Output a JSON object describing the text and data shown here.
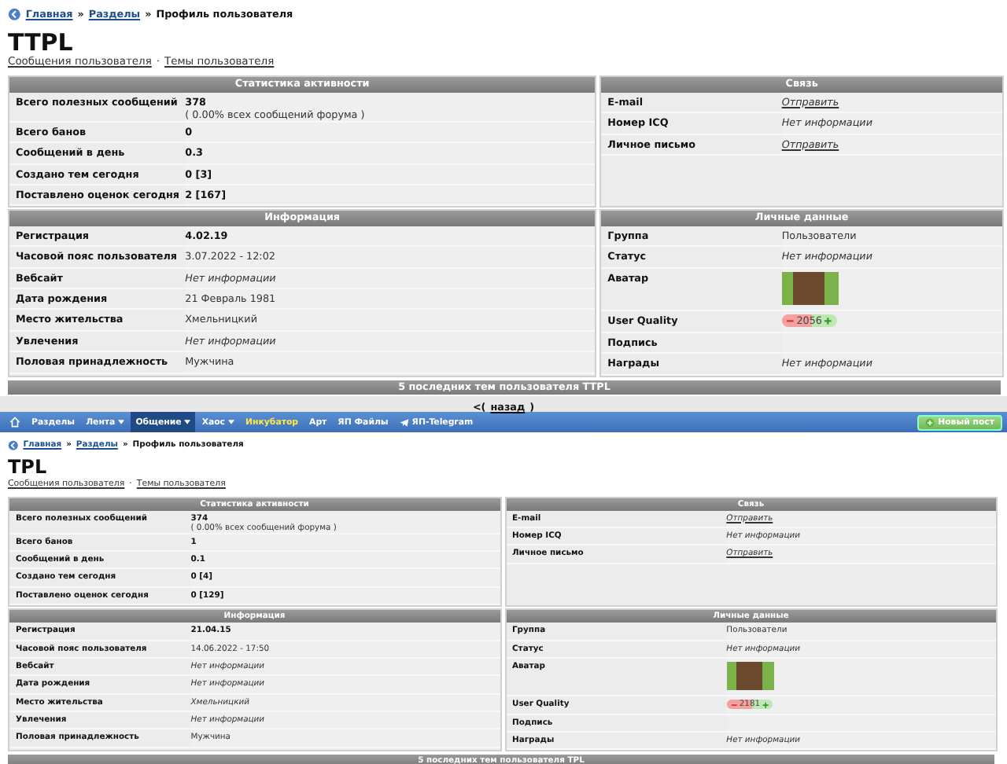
{
  "pages": [
    {
      "breadcrumb": {
        "links": [
          "Главная",
          "Разделы"
        ],
        "separator": "»",
        "current": "Профиль пользователя"
      },
      "title": "TTPL",
      "user_links": [
        "Сообщения пользователя",
        "Темы пользователя"
      ],
      "link_separator": "·",
      "sections": [
        {
          "title": "Статистика активности",
          "rows": [
            {
              "label": "Всего полезных сообщений",
              "kind": "bold",
              "value": "378",
              "note": "( 0.00% всех сообщений форума )"
            },
            {
              "label": "Всего банов",
              "kind": "bold",
              "value": "0"
            },
            {
              "label": "Сообщений в день",
              "kind": "bold",
              "value": "0.3"
            },
            {
              "label": "Создано тем сегодня",
              "kind": "bold",
              "value": "0 [3]"
            },
            {
              "label": "Поставлено оценок сегодня",
              "kind": "bold",
              "value": "2 [167]"
            }
          ]
        },
        {
          "title": "Связь",
          "rows": [
            {
              "label": "E-mail",
              "kind": "link",
              "value": "Отправить"
            },
            {
              "label": "Номер ICQ",
              "kind": "italic",
              "value": "Нет информации"
            },
            {
              "label": "Личное письмо",
              "kind": "link",
              "value": "Отправить"
            }
          ]
        },
        {
          "title": "Информация",
          "rows": [
            {
              "label": "Регистрация",
              "kind": "bold",
              "value": "4.02.19"
            },
            {
              "label": "Часовой пояс пользователя",
              "kind": "plain",
              "value": "3.07.2022 - 12:02"
            },
            {
              "label": "Вебсайт",
              "kind": "italic",
              "value": "Нет информации"
            },
            {
              "label": "Дата рождения",
              "kind": "plain",
              "value": "21 Февраль 1981"
            },
            {
              "label": "Место жительства",
              "kind": "plain",
              "value": "Хмельницкий"
            },
            {
              "label": "Увлечения",
              "kind": "italic",
              "value": "Нет информации"
            },
            {
              "label": "Половая принадлежность",
              "kind": "plain",
              "value": "Мужчина"
            }
          ]
        },
        {
          "title": "Личные данные",
          "rows": [
            {
              "label": "Группа",
              "kind": "plain",
              "value": "Пользователи"
            },
            {
              "label": "Статус",
              "kind": "italic",
              "value": "Нет информации"
            },
            {
              "label": "Аватар",
              "kind": "avatar"
            },
            {
              "label": "User Quality",
              "kind": "rating",
              "value": "2056"
            },
            {
              "label": "Подпись",
              "kind": "empty"
            },
            {
              "label": "Награды",
              "kind": "italic",
              "value": "Нет информации"
            }
          ]
        }
      ],
      "footer_title": "5 последних тем пользователя TTPL",
      "back": {
        "before": "<(",
        "link": "назад",
        "after": ")"
      }
    },
    {
      "navbar": {
        "items": [
          {
            "label": "Разделы",
            "dropdown": false,
            "selected": false,
            "highlighted": false
          },
          {
            "label": "Лента",
            "dropdown": true,
            "selected": false,
            "highlighted": false
          },
          {
            "label": "Общение",
            "dropdown": true,
            "selected": true,
            "highlighted": false
          },
          {
            "label": "Хаос",
            "dropdown": true,
            "selected": false,
            "highlighted": false
          },
          {
            "label": "Инкубатор",
            "dropdown": false,
            "selected": false,
            "highlighted": true
          },
          {
            "label": "Арт",
            "dropdown": false,
            "selected": false,
            "highlighted": false
          },
          {
            "label": "ЯП Файлы",
            "dropdown": false,
            "selected": false,
            "highlighted": false
          },
          {
            "label": "ЯП-Telegram",
            "dropdown": false,
            "selected": false,
            "highlighted": false,
            "kind": "telegram"
          }
        ],
        "new_post": "Новый пост"
      },
      "breadcrumb": {
        "links": [
          "Главная",
          "Разделы"
        ],
        "separator": "»",
        "current": "Профиль пользователя"
      },
      "title": "TPL",
      "user_links": [
        "Сообщения пользователя",
        "Темы пользователя"
      ],
      "link_separator": "·",
      "sections": [
        {
          "title": "Статистика активности",
          "rows": [
            {
              "label": "Всего полезных сообщений",
              "kind": "bold",
              "value": "374",
              "note": "( 0.00% всех сообщений форума )"
            },
            {
              "label": "Всего банов",
              "kind": "bold",
              "value": "1"
            },
            {
              "label": "Сообщений в день",
              "kind": "bold",
              "value": "0.1"
            },
            {
              "label": "Создано тем сегодня",
              "kind": "bold",
              "value": "0 [4]"
            },
            {
              "label": "Поставлено оценок сегодня",
              "kind": "bold",
              "value": "0 [129]"
            }
          ]
        },
        {
          "title": "Связь",
          "rows": [
            {
              "label": "E-mail",
              "kind": "link",
              "value": "Отправить"
            },
            {
              "label": "Номер ICQ",
              "kind": "italic",
              "value": "Нет информации"
            },
            {
              "label": "Личное письмо",
              "kind": "link",
              "value": "Отправить"
            }
          ]
        },
        {
          "title": "Информация",
          "rows": [
            {
              "label": "Регистрация",
              "kind": "bold",
              "value": "21.04.15"
            },
            {
              "label": "Часовой пояс пользователя",
              "kind": "plain",
              "value": "14.06.2022 - 17:50"
            },
            {
              "label": "Вебсайт",
              "kind": "italic",
              "value": "Нет информации"
            },
            {
              "label": "Дата рождения",
              "kind": "italic",
              "value": "Нет информации"
            },
            {
              "label": "Место жительства",
              "kind": "italic",
              "value": "Хмельницкий"
            },
            {
              "label": "Увлечения",
              "kind": "italic",
              "value": "Нет информации"
            },
            {
              "label": "Половая принадлежность",
              "kind": "plain",
              "value": "Мужчина"
            }
          ]
        },
        {
          "title": "Личные данные",
          "rows": [
            {
              "label": "Группа",
              "kind": "plain",
              "value": "Пользователи"
            },
            {
              "label": "Статус",
              "kind": "italic",
              "value": "Нет информации"
            },
            {
              "label": "Аватар",
              "kind": "avatar"
            },
            {
              "label": "User Quality",
              "kind": "rating",
              "value": "2181"
            },
            {
              "label": "Подпись",
              "kind": "empty"
            },
            {
              "label": "Награды",
              "kind": "italic",
              "value": "Нет информации"
            }
          ]
        }
      ],
      "footer_title": "5 последних тем пользователя TPL"
    }
  ]
}
